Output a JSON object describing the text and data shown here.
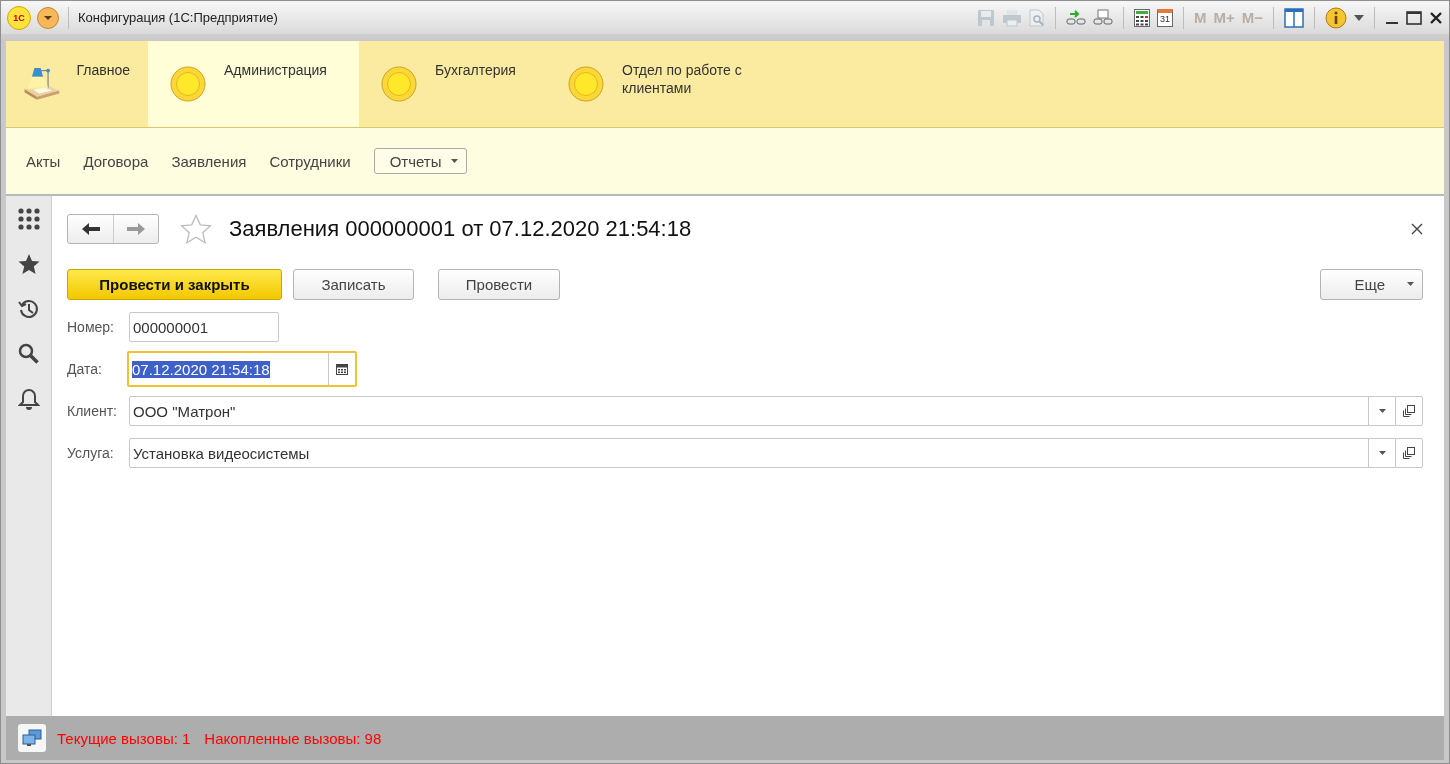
{
  "window": {
    "logo": "1С",
    "title": "Конфигурация (1С:Предприятие)",
    "calendar_day": "31",
    "memory_buttons": [
      {
        "label": "M",
        "disabled": true
      },
      {
        "label": "M+",
        "disabled": true
      },
      {
        "label": "M−",
        "disabled": true
      }
    ]
  },
  "sections": [
    {
      "label": "Главное",
      "kind": "lamp",
      "selected": false
    },
    {
      "label": "Администрация",
      "kind": "circle",
      "selected": true
    },
    {
      "label": "Бухгалтерия",
      "kind": "circle",
      "selected": false
    },
    {
      "label": "Отдел по работе с клиентами",
      "kind": "circle",
      "selected": false
    }
  ],
  "nav": [
    {
      "label": "Акты",
      "kind": "link"
    },
    {
      "label": "Договора",
      "kind": "link"
    },
    {
      "label": "Заявления",
      "kind": "link"
    },
    {
      "label": "Сотрудники",
      "kind": "link"
    },
    {
      "label": "Отчеты",
      "kind": "dropdown"
    }
  ],
  "form": {
    "title": "Заявления 000000001 от 07.12.2020 21:54:18",
    "favorite": false,
    "buttons": [
      {
        "label": "Провести и закрыть",
        "kind": "primary"
      },
      {
        "label": "Записать",
        "kind": "default"
      },
      {
        "label": "Провести",
        "kind": "default"
      }
    ],
    "more": "Еще",
    "fields": [
      {
        "label": "Номер:",
        "value": "000000001",
        "kind": "text",
        "focused": false
      },
      {
        "label": "Дата:",
        "value": "07.12.2020 21:54:18",
        "kind": "date",
        "focused": true
      },
      {
        "label": "Клиент:",
        "value": "ООО \"Матрон\"",
        "kind": "ref",
        "focused": false
      },
      {
        "label": "Услуга:",
        "value": "Установка видеосистемы",
        "kind": "ref",
        "focused": false
      }
    ]
  },
  "status_bar": {
    "items": [
      "Текущие вызовы: 1",
      "Накопленные вызовы: 98"
    ]
  }
}
